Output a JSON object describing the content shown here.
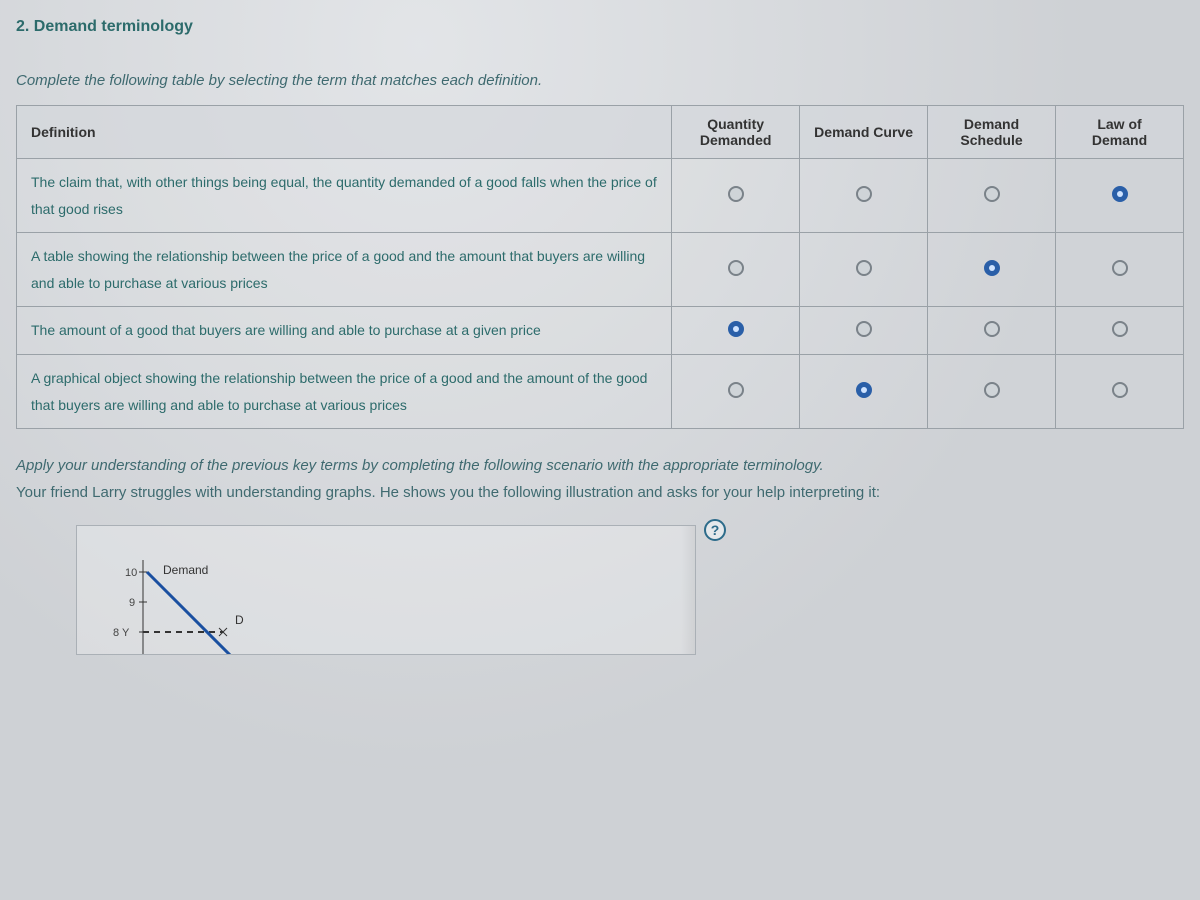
{
  "section_title": "2. Demand terminology",
  "instruction": "Complete the following table by selecting the term that matches each definition.",
  "table": {
    "headers": {
      "definition": "Definition",
      "col1": "Quantity Demanded",
      "col2": "Demand Curve",
      "col3": "Demand Schedule",
      "col4": "Law of Demand"
    },
    "rows": [
      {
        "definition": "The claim that, with other things being equal, the quantity demanded of a good falls when the price of that good rises",
        "selected": 4
      },
      {
        "definition": "A table showing the relationship between the price of a good and the amount that buyers are willing and able to purchase at various prices",
        "selected": 3
      },
      {
        "definition": "The amount of a good that buyers are willing and able to purchase at a given price",
        "selected": 1
      },
      {
        "definition": "A graphical object showing the relationship between the price of a good and the amount of the good that buyers are willing and able to purchase at various prices",
        "selected": 2
      }
    ]
  },
  "para1": "Apply your understanding of the previous key terms by completing the following scenario with the appropriate terminology.",
  "para2": "Your friend Larry struggles with understanding graphs. He shows you the following illustration and asks for your help interpreting it:",
  "help_glyph": "?",
  "chart_data": {
    "type": "line",
    "series_name": "Demand",
    "point_label": "D",
    "y_ticks": [
      10,
      9,
      "8  Y"
    ],
    "visible_points": [
      {
        "x": 0,
        "y": 10
      },
      {
        "x": 2,
        "y": 8
      }
    ],
    "dashed_ref_y": 8
  }
}
